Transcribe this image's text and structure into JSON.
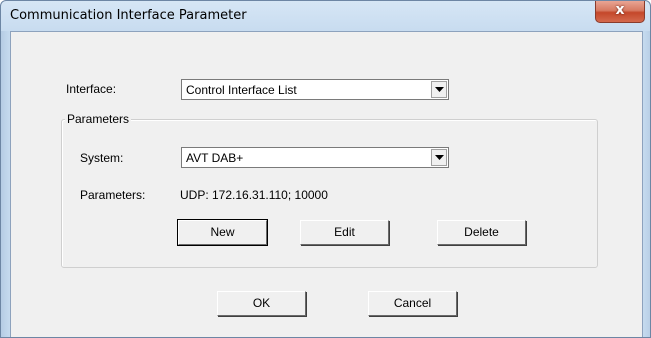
{
  "window": {
    "title": "Communication Interface Parameter",
    "close_glyph": "x"
  },
  "interface": {
    "label": "Interface:",
    "selected": "Control Interface List"
  },
  "parameters_group": {
    "legend": "Parameters",
    "system_label": "System:",
    "system_selected": "AVT DAB+",
    "params_label": "Parameters:",
    "params_value": "UDP: 172.16.31.110; 10000"
  },
  "buttons": {
    "new": "New",
    "edit": "Edit",
    "delete": "Delete",
    "ok": "OK",
    "cancel": "Cancel"
  },
  "icons": {
    "close": "close-icon",
    "dropdown": "chevron-down-icon"
  },
  "colors": {
    "title_bar": "#c3d8ee",
    "client_bg": "#f0f0f0",
    "close_button": "#c4472a"
  }
}
